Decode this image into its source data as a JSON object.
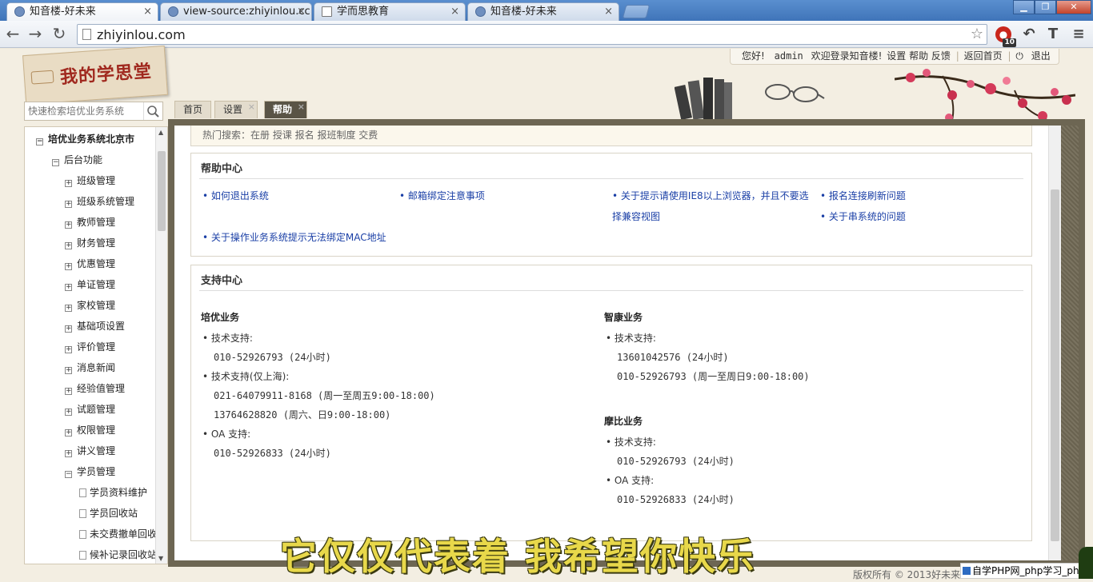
{
  "browser": {
    "tabs": [
      {
        "label": "知音楼-好未来",
        "active": true
      },
      {
        "label": "view-source:zhiyinlou.cc",
        "active": false
      },
      {
        "label": "学而思教育",
        "active": false
      },
      {
        "label": "知音楼-好未来",
        "active": false
      }
    ],
    "close_glyph": "×",
    "url": "zhiyinlou.com",
    "extension_badge": "10",
    "window_buttons": {
      "minimize": "▁",
      "maximize": "❐",
      "close": "✕"
    }
  },
  "header": {
    "logo_text": "我的学思堂",
    "greeting": "您好!",
    "username": "admin",
    "welcome": "欢迎登录知音楼!",
    "links": [
      "设置",
      "帮助",
      "反馈"
    ],
    "back_home": "返回首页",
    "logout": "退出"
  },
  "search": {
    "placeholder": "快速检索培优业务系统"
  },
  "page_tabs": [
    {
      "label": "首页",
      "active": false,
      "closable": false
    },
    {
      "label": "设置",
      "active": false,
      "closable": true
    },
    {
      "label": "帮助",
      "active": true,
      "closable": true
    }
  ],
  "sidebar": {
    "root": "培优业务系统北京市",
    "group": "后台功能",
    "items": [
      "班级管理",
      "班级系统管理",
      "教师管理",
      "财务管理",
      "优惠管理",
      "单证管理",
      "家校管理",
      "基础项设置",
      "评价管理",
      "消息新闻",
      "经验值管理",
      "试题管理",
      "权限管理",
      "讲义管理",
      "学员管理"
    ],
    "leaves": [
      "学员资料维护",
      "学员回收站",
      "未交费撤单回收",
      "候补记录回收站"
    ]
  },
  "content": {
    "top_cut_text": "热门搜索：在册 授课 报名 报班制度 交费",
    "help_center": {
      "title": "帮助中心",
      "links": [
        "如何退出系统",
        "邮箱绑定注意事项",
        "关于提示请使用IE8以上浏览器，并且不要选",
        "择兼容视图",
        "报名连接刷新问题",
        "关于串系统的问题",
        "关于操作业务系统提示无法绑定MAC地址"
      ]
    },
    "support_center": {
      "title": "支持中心",
      "peiyou": {
        "title": "培优业务",
        "label1": "技术支持:",
        "line1": "010-52926793 (24小时)",
        "label2": "技术支持(仅上海):",
        "line2": "021-64079911-8168 (周一至周五9:00-18:00)",
        "line3": "13764628820 (周六、日9:00-18:00)",
        "label3": "OA 支持:",
        "line4": "010-52926833 (24小时)"
      },
      "zhikang": {
        "title": "智康业务",
        "label1": "技术支持:",
        "line1": "13601042576 (24小时)",
        "line2": "010-52926793 (周一至周日9:00-18:00)"
      },
      "mobi": {
        "title": "摩比业务",
        "label1": "技术支持:",
        "line1": "010-52926793 (24小时)",
        "label2": "OA 支持:",
        "line2": "010-52926833 (24小时)"
      }
    }
  },
  "overlay": {
    "subtitle": "它仅仅代表着 我希望你快乐",
    "copyright": "版权所有 © 2013好未来",
    "watermark": "自学PHP网_php学习_php教"
  }
}
